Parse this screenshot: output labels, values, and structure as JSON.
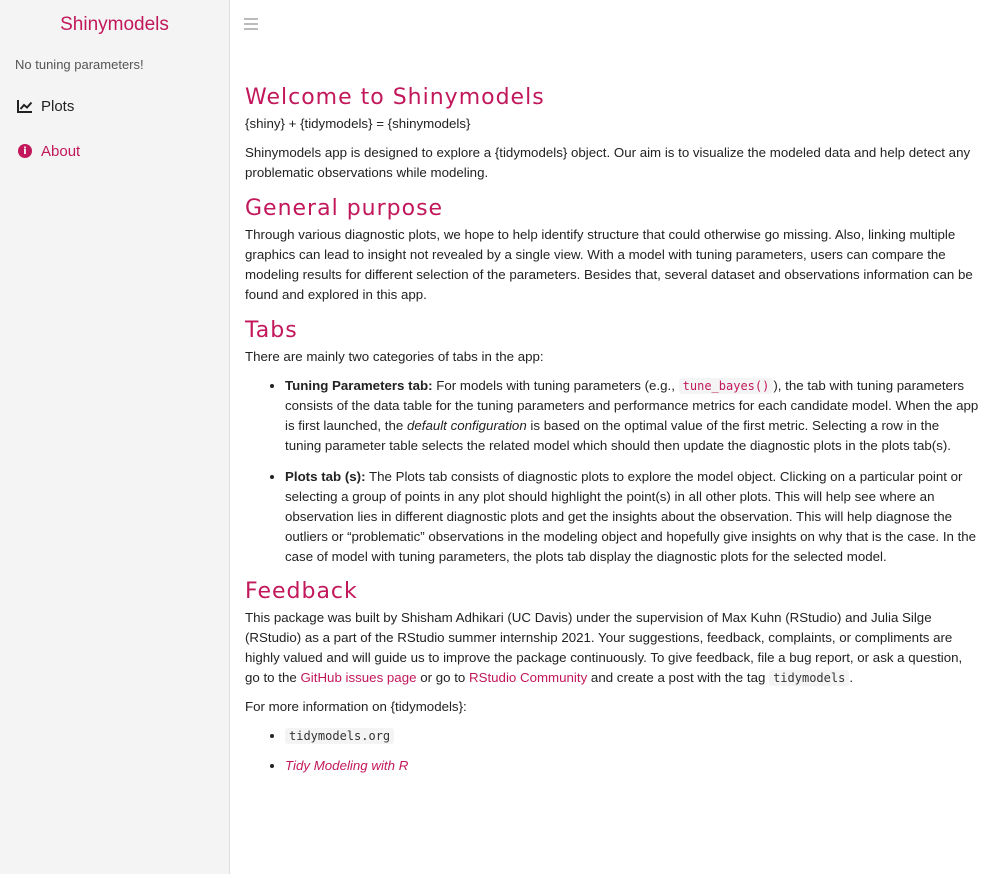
{
  "sidebar": {
    "brand": "Shinymodels",
    "note": "No tuning parameters!",
    "items": [
      {
        "label": "Plots",
        "icon": "line-chart-icon"
      },
      {
        "label": "About",
        "icon": "info-circle-icon"
      }
    ],
    "active": "About"
  },
  "colors": {
    "accent": "#c2185b",
    "sidebar_bg": "#f4f4f4"
  },
  "content": {
    "welcome": {
      "title": "Welcome to Shinymodels",
      "formula": "{shiny} + {tidymodels} = {shinymodels}",
      "intro": "Shinymodels app is designed to explore a {tidymodels} object. Our aim is to visualize the modeled data and help detect any problematic observations while modeling."
    },
    "purpose": {
      "title": "General purpose",
      "body": "Through various diagnostic plots, we hope to help identify structure that could otherwise go missing. Also, linking multiple graphics can lead to insight not revealed by a single view. With a model with tuning parameters, users can compare the modeling results for different selection of the parameters. Besides that, several dataset and observations information can be found and explored in this app."
    },
    "tabs": {
      "title": "Tabs",
      "intro": "There are mainly two categories of tabs in the app:",
      "tuning": {
        "label": "Tuning Parameters tab:",
        "t1": " For models with tuning parameters (e.g., ",
        "code": "tune_bayes()",
        "t2": "), the tab with tuning parameters consists of the data table for the tuning parameters and performance metrics for each candidate model. When the app is first launched, the ",
        "em": "default configuration",
        "t3": " is based on the optimal value of the first metric. Selecting a row in the tuning parameter table selects the related model which should then update the diagnostic plots in the plots tab(s)."
      },
      "plots": {
        "label": "Plots tab (s):",
        "text": " The Plots tab consists of diagnostic plots to explore the model object. Clicking on a particular point or selecting a group of points in any plot should highlight the point(s) in all other plots. This will help see where an observation lies in different diagnostic plots and get the insights about the observation. This will help diagnose the outliers or “problematic” observations in the modeling object and hopefully give insights on why that is the case. In the case of model with tuning parameters, the plots tab display the diagnostic plots for the selected model."
      }
    },
    "feedback": {
      "title": "Feedback",
      "t1": "This package was built by Shisham Adhikari (UC Davis) under the supervision of Max Kuhn (RStudio) and Julia Silge (RStudio) as a part of the RStudio summer internship 2021. Your suggestions, feedback, complaints, or compliments are highly valued and will guide us to improve the package continuously. To give feedback, file a bug report, or ask a question, go to the ",
      "link1": "GitHub issues page",
      "t2": " or go to ",
      "link2": "RStudio Community",
      "t3": " and create a post with the tag ",
      "code": "tidymodels",
      "t4": ".",
      "more": "For more information on {tidymodels}:",
      "links": {
        "site": "tidymodels.org",
        "book": "Tidy Modeling with R"
      }
    }
  }
}
